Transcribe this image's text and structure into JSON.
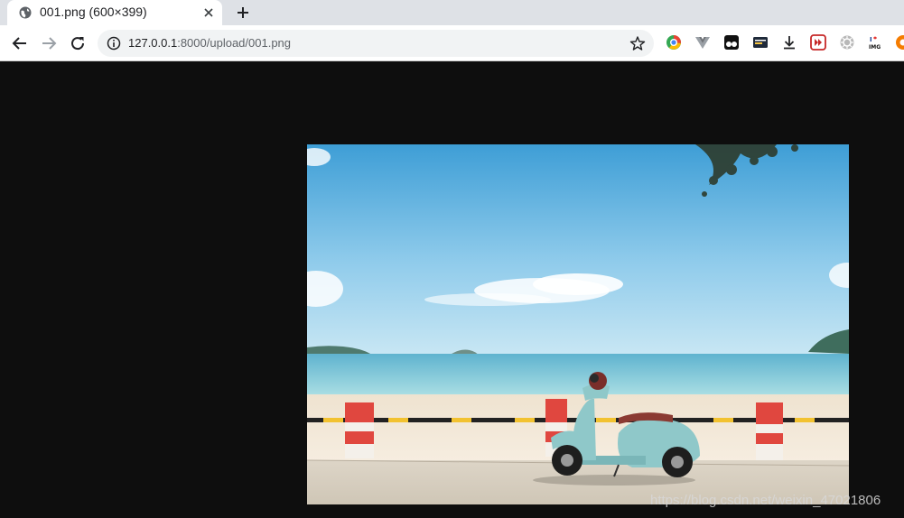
{
  "tab": {
    "title": "001.png (600×399)",
    "favicon": "globe-icon",
    "close_icon": "close-icon"
  },
  "new_tab_icon": "plus-icon",
  "toolbar": {
    "back_icon": "back-arrow-icon",
    "forward_icon": "forward-arrow-icon",
    "reload_icon": "reload-icon",
    "url_host": "127.0.0.1",
    "url_rest": ":8000/upload/001.png",
    "info_icon": "info-icon",
    "bookmark_icon": "star-icon"
  },
  "extensions": [
    "chrome-color-icon",
    "vue-devtools-icon",
    "tampermonkey-icon",
    "extension-card-icon",
    "download-icon",
    "media-forward-icon",
    "gear-icon",
    "img-icon",
    "orange-extension-icon"
  ],
  "image": {
    "filename": "001.png",
    "width": 600,
    "height": 399,
    "subject": "blue scooter parked by a seaside railing"
  },
  "watermark": "https://blog.csdn.net/weixin_47021806",
  "colors": {
    "page_background": "#0e0e0e",
    "sky_top": "#4fa7d9",
    "sea": "#7cc6d8",
    "scooter": "#8fc8c9",
    "railing_red": "#e0473f"
  }
}
